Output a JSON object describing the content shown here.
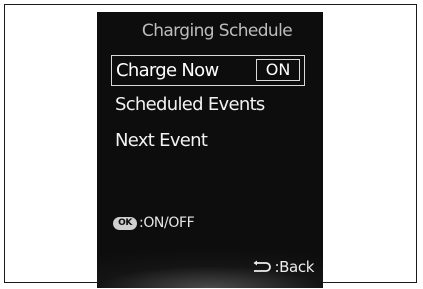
{
  "screen": {
    "title": "Charging Schedule",
    "menu": {
      "charge_now": {
        "label": "Charge Now",
        "value": "ON"
      },
      "scheduled_events": {
        "label": "Scheduled Events"
      },
      "next_event": {
        "label": "Next Event"
      }
    },
    "hint": {
      "button": "OK",
      "text": ":ON/OFF"
    },
    "back": {
      "text": ":Back",
      "icon": "back-arrow-icon"
    }
  }
}
